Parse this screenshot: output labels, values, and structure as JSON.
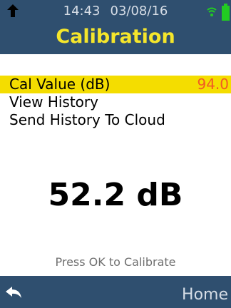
{
  "status_bar": {
    "time": "14:43",
    "date": "03/08/16"
  },
  "header": {
    "title": "Calibration"
  },
  "menu": {
    "items": [
      {
        "label": "Cal Value (dB)",
        "value": "94.0"
      },
      {
        "label": "View History"
      },
      {
        "label": "Send History To Cloud"
      }
    ]
  },
  "reading": {
    "value": "52.2 dB"
  },
  "hint": "Press OK to Calibrate",
  "footer": {
    "home_label": "Home"
  },
  "icons": {
    "up": "up-arrow-icon",
    "wifi": "wifi-icon",
    "battery": "battery-icon",
    "back": "back-arrow-icon"
  },
  "colors": {
    "header_bg": "#2f4f6f",
    "title": "#f5e62b",
    "selection": "#f4dd00",
    "value": "#f15a24",
    "battery": "#22cc22"
  }
}
